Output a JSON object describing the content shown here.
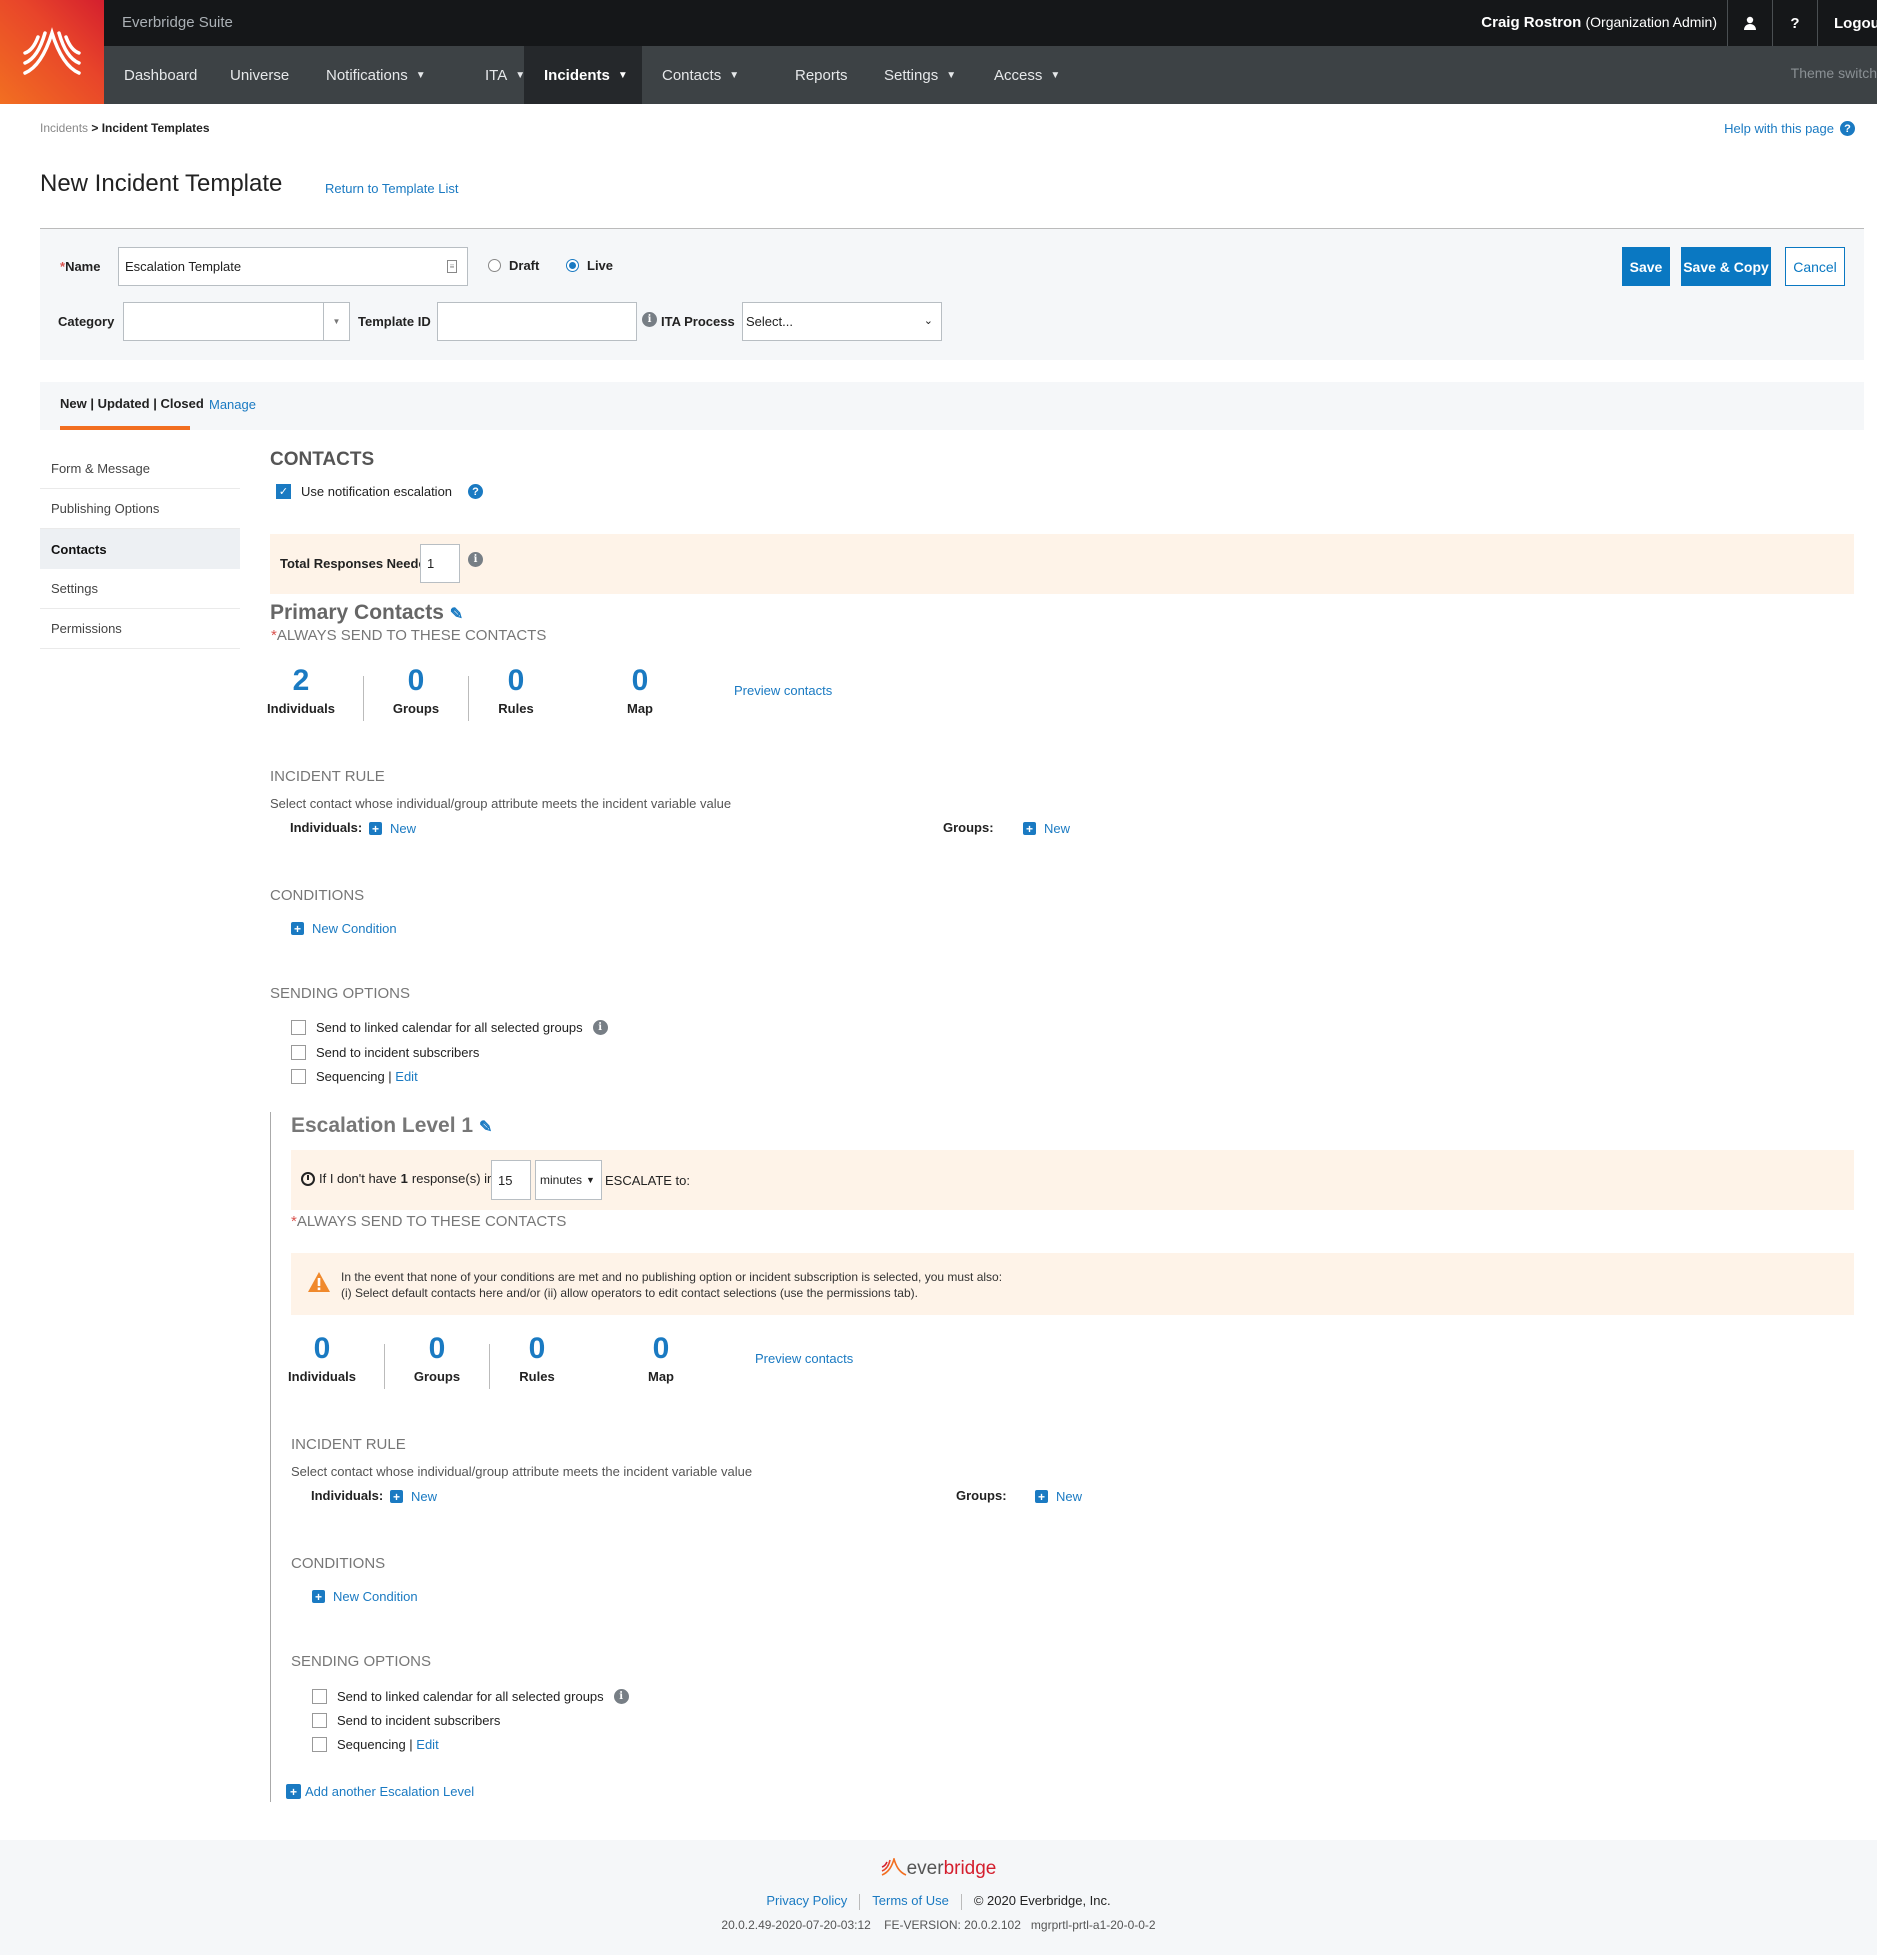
{
  "header": {
    "suite_name": "Everbridge Suite",
    "user_name": "Craig Rostron",
    "user_role": "(Organization Admin)",
    "user_icon": "user-icon",
    "help_glyph": "?",
    "logout_label": "Logout",
    "theme_switch": "Theme switch"
  },
  "nav": {
    "items": [
      {
        "label": "Dashboard",
        "dropdown": false
      },
      {
        "label": "Universe",
        "dropdown": false
      },
      {
        "label": "Notifications",
        "dropdown": true
      },
      {
        "label": "ITA",
        "dropdown": true
      },
      {
        "label": "Incidents",
        "dropdown": true,
        "active": true
      },
      {
        "label": "Contacts",
        "dropdown": true
      },
      {
        "label": "Reports",
        "dropdown": false
      },
      {
        "label": "Settings",
        "dropdown": true
      },
      {
        "label": "Access",
        "dropdown": true
      }
    ],
    "chevron": "⌄"
  },
  "breadcrumb": {
    "parent": "Incidents",
    "separator": " > ",
    "current": "Incident Templates"
  },
  "help_link": "Help with this page",
  "page": {
    "title": "New Incident Template",
    "return_link": "Return to Template List"
  },
  "form": {
    "name_label": "Name",
    "required_mark": "*",
    "name_value": "Escalation Template",
    "status_options": [
      {
        "label": "Draft",
        "selected": false
      },
      {
        "label": "Live",
        "selected": true
      }
    ],
    "category_label": "Category",
    "category_value": "",
    "template_id_label": "Template ID",
    "template_id_value": "",
    "ita_process_label": "ITA Process",
    "ita_process_value": "Select...",
    "buttons": {
      "save": "Save",
      "save_copy": "Save & Copy",
      "cancel": "Cancel"
    }
  },
  "tabs": {
    "phase": "New | Updated | Closed",
    "manage": "Manage"
  },
  "sidebar": {
    "items": [
      {
        "label": "Form & Message",
        "active": false
      },
      {
        "label": "Publishing Options",
        "active": false
      },
      {
        "label": "Contacts",
        "active": true
      },
      {
        "label": "Settings",
        "active": false
      },
      {
        "label": "Permissions",
        "active": false
      }
    ]
  },
  "contacts": {
    "heading": "CONTACTS",
    "use_escalation_label": "Use notification escalation",
    "use_escalation_checked": true,
    "total_responses_label": "Total Responses Needed",
    "total_responses_value": "1",
    "primary": {
      "title": "Primary Contacts",
      "always_send": "ALWAYS SEND TO THESE CONTACTS",
      "stats": [
        {
          "value": "2",
          "label": "Individuals"
        },
        {
          "value": "0",
          "label": "Groups"
        },
        {
          "value": "0",
          "label": "Rules"
        },
        {
          "value": "0",
          "label": "Map"
        }
      ],
      "preview_link": "Preview contacts",
      "incident_rule_heading": "INCIDENT RULE",
      "incident_rule_desc": "Select contact whose individual/group attribute meets the incident variable value",
      "individuals_label": "Individuals:",
      "groups_label": "Groups:",
      "new_label": "New",
      "conditions_heading": "CONDITIONS",
      "new_condition": "New Condition",
      "sending_heading": "SENDING OPTIONS",
      "sending_options": [
        {
          "label": "Send to linked calendar for all selected groups",
          "checked": false,
          "info": true
        },
        {
          "label": "Send to incident subscribers",
          "checked": false
        },
        {
          "label": "Sequencing",
          "checked": false,
          "edit": "Edit"
        }
      ]
    },
    "escalation": {
      "title": "Escalation Level 1",
      "rule_prefix": "If I don't have",
      "responses": "1",
      "rule_mid": "response(s) in",
      "duration": "15",
      "unit": "minutes",
      "rule_suffix": "ESCALATE to:",
      "always_send": "ALWAYS SEND TO THESE CONTACTS",
      "warning_line1": "In the event that none of your conditions are met and no publishing option or incident subscription is selected, you must also:",
      "warning_line2": "(i) Select default contacts here and/or (ii) allow operators to edit contact selections (use the permissions tab).",
      "stats": [
        {
          "value": "0",
          "label": "Individuals"
        },
        {
          "value": "0",
          "label": "Groups"
        },
        {
          "value": "0",
          "label": "Rules"
        },
        {
          "value": "0",
          "label": "Map"
        }
      ],
      "preview_link": "Preview contacts",
      "incident_rule_heading": "INCIDENT RULE",
      "incident_rule_desc": "Select contact whose individual/group attribute meets the incident variable value",
      "individuals_label": "Individuals:",
      "groups_label": "Groups:",
      "new_label": "New",
      "conditions_heading": "CONDITIONS",
      "new_condition": "New Condition",
      "sending_heading": "SENDING OPTIONS",
      "sending_options": [
        {
          "label": "Send to linked calendar for all selected groups",
          "checked": false,
          "info": true
        },
        {
          "label": "Send to incident subscribers",
          "checked": false
        },
        {
          "label": "Sequencing",
          "checked": false,
          "edit": "Edit"
        }
      ]
    },
    "add_level": "Add another Escalation Level"
  },
  "footer": {
    "brand_ever": "ever",
    "brand_bridge": "bridge",
    "privacy": "Privacy Policy",
    "terms": "Terms of Use",
    "copyright": "©  2020 Everbridge, Inc.",
    "version": "20.0.2.49-2020-07-20-03:12    FE-VERSION: 20.0.2.102   mgrprtl-prtl-a1-20-0-0-2"
  },
  "colors": {
    "accent": "#0a78c2",
    "orange": "#f26f21",
    "band": "#fef3e8",
    "nav": "#3d4245",
    "topbar": "#151719"
  }
}
